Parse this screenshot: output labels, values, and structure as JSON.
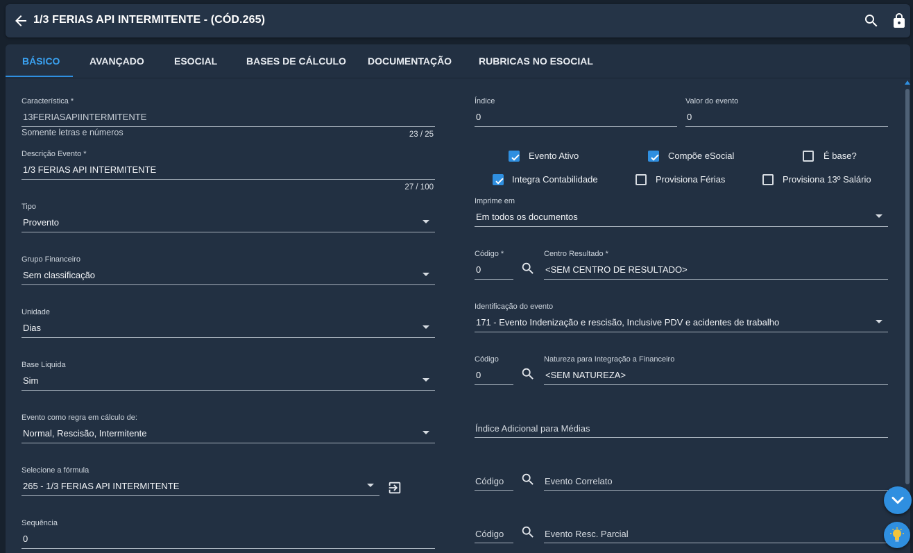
{
  "header": {
    "title": "1/3 FERIAS API INTERMITENTE - (CÓD.265)"
  },
  "tabs": [
    {
      "label": "BÁSICO"
    },
    {
      "label": "AVANÇADO"
    },
    {
      "label": "ESOCIAL"
    },
    {
      "label": "BASES DE CÁLCULO"
    },
    {
      "label": "DOCUMENTAÇÃO"
    },
    {
      "label": "RUBRICAS NO ESOCIAL"
    }
  ],
  "left": {
    "caracteristica": {
      "label": "Característica *",
      "value": "13FERIASAPIINTERMITENTE",
      "hint": "Somente letras e números",
      "counter": "23 / 25"
    },
    "descricao": {
      "label": "Descrição Evento *",
      "value": "1/3 FERIAS API INTERMITENTE",
      "counter": "27 / 100"
    },
    "tipo": {
      "label": "Tipo",
      "value": "Provento"
    },
    "grupo": {
      "label": "Grupo Financeiro",
      "value": "Sem classificação"
    },
    "unidade": {
      "label": "Unidade",
      "value": "Dias"
    },
    "base_liquida": {
      "label": "Base Liquida",
      "value": "Sim"
    },
    "regra": {
      "label": "Evento como regra em cálculo de:",
      "value": "Normal, Rescisão, Intermitente"
    },
    "formula": {
      "label": "Selecione a fórmula",
      "value": "265 - 1/3 FERIAS API INTERMITENTE"
    },
    "sequencia": {
      "label": "Sequência",
      "value": "0"
    }
  },
  "right": {
    "indice": {
      "label": "Índice",
      "value": "0"
    },
    "valor": {
      "label": "Valor do evento",
      "value": "0"
    },
    "checkboxes": {
      "evento_ativo": {
        "label": "Evento Ativo",
        "checked": true
      },
      "compoe_esocial": {
        "label": "Compõe eSocial",
        "checked": true
      },
      "e_base": {
        "label": "É base?",
        "checked": false
      },
      "integra_contabilidade": {
        "label": "Integra Contabilidade",
        "checked": true
      },
      "provisiona_ferias": {
        "label": "Provisiona Férias",
        "checked": false
      },
      "provisiona_13": {
        "label": "Provisiona 13º Salário",
        "checked": false
      }
    },
    "imprime": {
      "label": "Imprime em",
      "value": "Em todos os documentos"
    },
    "codigo_cr": {
      "label": "Código *",
      "value": "0"
    },
    "centro_resultado": {
      "label": "Centro Resultado *",
      "value": "<SEM CENTRO DE RESULTADO>"
    },
    "identificacao": {
      "label": "Identificação do evento",
      "value": "171 - Evento Indenização e rescisão, Inclusive PDV e acidentes de trabalho"
    },
    "codigo_nat": {
      "label": "Código",
      "value": "0"
    },
    "natureza": {
      "label": "Natureza para Integração a Financeiro",
      "value": "<SEM NATUREZA>"
    },
    "indice_adicional": {
      "placeholder": "Índice Adicional para Médias"
    },
    "correlato": {
      "codigo_placeholder": "Código",
      "placeholder": "Evento Correlato"
    },
    "resc_parcial": {
      "codigo_placeholder": "Código",
      "placeholder": "Evento Resc. Parcial"
    }
  },
  "colors": {
    "accent": "#2f8fe0",
    "background": "#17212d",
    "panel": "#223042"
  }
}
